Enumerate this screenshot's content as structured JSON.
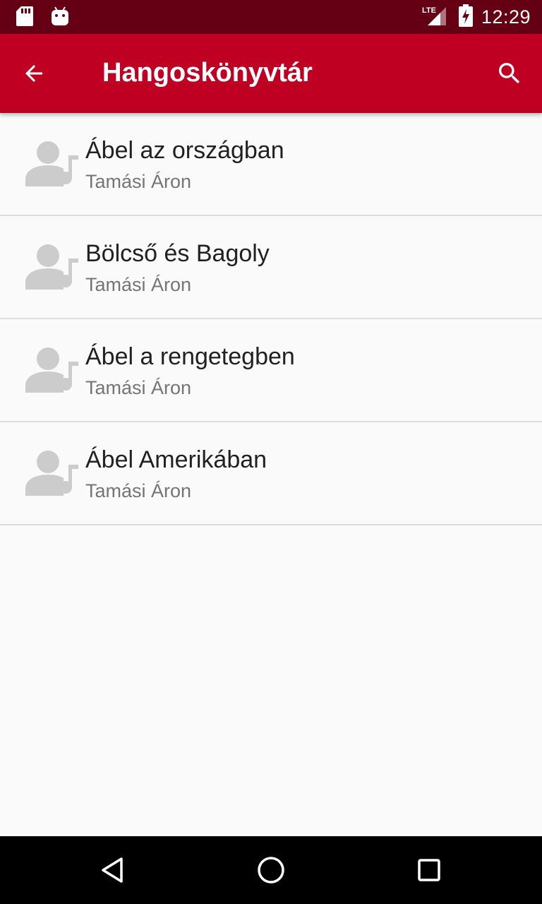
{
  "status_bar": {
    "time": "12:29",
    "network": "LTE",
    "icons": [
      "sd-card-icon",
      "android-icon",
      "signal-icon",
      "battery-charging-icon"
    ]
  },
  "app_bar": {
    "title": "Hangoskönyvtár",
    "back_icon": "arrow-back-icon",
    "search_icon": "search-icon",
    "color": "#bf0023",
    "status_color": "#650014"
  },
  "books": [
    {
      "title": "Ábel az országban",
      "author": "Tamási Áron",
      "icon": "audiobook-person-music-icon"
    },
    {
      "title": "Bölcső és Bagoly",
      "author": "Tamási Áron",
      "icon": "audiobook-person-music-icon"
    },
    {
      "title": "Ábel a rengetegben",
      "author": "Tamási Áron",
      "icon": "audiobook-person-music-icon"
    },
    {
      "title": "Ábel Amerikában",
      "author": "Tamási Áron",
      "icon": "audiobook-person-music-icon"
    }
  ],
  "nav_bar": {
    "buttons": [
      "back-triangle-icon",
      "home-circle-icon",
      "recents-square-icon"
    ]
  }
}
